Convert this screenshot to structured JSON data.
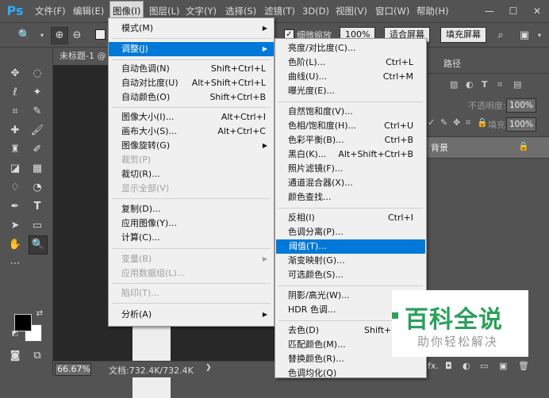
{
  "app": {
    "logo": "Ps"
  },
  "menubar": {
    "items": [
      {
        "label": "文件(F)"
      },
      {
        "label": "编辑(E)"
      },
      {
        "label": "图像(I)"
      },
      {
        "label": "图层(L)"
      },
      {
        "label": "文字(Y)"
      },
      {
        "label": "选择(S)"
      },
      {
        "label": "滤镜(T)"
      },
      {
        "label": "3D(D)"
      },
      {
        "label": "视图(V)"
      },
      {
        "label": "窗口(W)"
      },
      {
        "label": "帮助(H)"
      }
    ],
    "window_buttons": {
      "minimize": "—",
      "maximize": "☐",
      "close": "✕"
    }
  },
  "options_bar": {
    "scrubby_zoom_label": "细微缩放",
    "zoom_100_btn": "100%",
    "fit_screen_btn": "适合屏幕",
    "fill_screen_btn": "填充屏幕"
  },
  "document": {
    "tab_title": "未标题-1 @",
    "zoom_value": "66.67%",
    "doc_info": "文档:732.4K/732.4K"
  },
  "layers_panel": {
    "tab_paths": "路径",
    "opacity_label": "不透明度:",
    "opacity_value": "100%",
    "fill_label": "填充:",
    "fill_value": "100%",
    "layer_name": "背景"
  },
  "image_menu": {
    "items": [
      {
        "label": "模式(M)",
        "shortcut": "",
        "submenu": true,
        "disabled": false,
        "highlighted": false
      },
      {
        "label": "调整(J)",
        "shortcut": "",
        "submenu": true,
        "disabled": false,
        "highlighted": true
      },
      {
        "label": "自动色调(N)",
        "shortcut": "Shift+Ctrl+L",
        "submenu": false,
        "disabled": false,
        "highlighted": false
      },
      {
        "label": "自动对比度(U)",
        "shortcut": "Alt+Shift+Ctrl+L",
        "submenu": false,
        "disabled": false,
        "highlighted": false
      },
      {
        "label": "自动颜色(O)",
        "shortcut": "Shift+Ctrl+B",
        "submenu": false,
        "disabled": false,
        "highlighted": false
      },
      {
        "label": "图像大小(I)...",
        "shortcut": "Alt+Ctrl+I",
        "submenu": false,
        "disabled": false,
        "highlighted": false
      },
      {
        "label": "画布大小(S)...",
        "shortcut": "Alt+Ctrl+C",
        "submenu": false,
        "disabled": false,
        "highlighted": false
      },
      {
        "label": "图像旋转(G)",
        "shortcut": "",
        "submenu": true,
        "disabled": false,
        "highlighted": false
      },
      {
        "label": "裁剪(P)",
        "shortcut": "",
        "submenu": false,
        "disabled": true,
        "highlighted": false
      },
      {
        "label": "裁切(R)...",
        "shortcut": "",
        "submenu": false,
        "disabled": false,
        "highlighted": false
      },
      {
        "label": "显示全部(V)",
        "shortcut": "",
        "submenu": false,
        "disabled": true,
        "highlighted": false
      },
      {
        "label": "复制(D)...",
        "shortcut": "",
        "submenu": false,
        "disabled": false,
        "highlighted": false
      },
      {
        "label": "应用图像(Y)...",
        "shortcut": "",
        "submenu": false,
        "disabled": false,
        "highlighted": false
      },
      {
        "label": "计算(C)...",
        "shortcut": "",
        "submenu": false,
        "disabled": false,
        "highlighted": false
      },
      {
        "label": "变量(B)",
        "shortcut": "",
        "submenu": true,
        "disabled": true,
        "highlighted": false
      },
      {
        "label": "应用数据组(L)...",
        "shortcut": "",
        "submenu": false,
        "disabled": true,
        "highlighted": false
      },
      {
        "label": "陷印(T)...",
        "shortcut": "",
        "submenu": false,
        "disabled": true,
        "highlighted": false
      },
      {
        "label": "分析(A)",
        "shortcut": "",
        "submenu": true,
        "disabled": false,
        "highlighted": false
      }
    ]
  },
  "adjust_menu": {
    "items": [
      {
        "label": "亮度/对比度(C)...",
        "shortcut": "",
        "highlighted": false
      },
      {
        "label": "色阶(L)...",
        "shortcut": "Ctrl+L",
        "highlighted": false
      },
      {
        "label": "曲线(U)...",
        "shortcut": "Ctrl+M",
        "highlighted": false
      },
      {
        "label": "曝光度(E)...",
        "shortcut": "",
        "highlighted": false
      },
      {
        "label": "自然饱和度(V)...",
        "shortcut": "",
        "highlighted": false
      },
      {
        "label": "色相/饱和度(H)...",
        "shortcut": "Ctrl+U",
        "highlighted": false
      },
      {
        "label": "色彩平衡(B)...",
        "shortcut": "Ctrl+B",
        "highlighted": false
      },
      {
        "label": "黑白(K)...",
        "shortcut": "Alt+Shift+Ctrl+B",
        "highlighted": false
      },
      {
        "label": "照片滤镜(F)...",
        "shortcut": "",
        "highlighted": false
      },
      {
        "label": "通道混合器(X)...",
        "shortcut": "",
        "highlighted": false
      },
      {
        "label": "颜色查找...",
        "shortcut": "",
        "highlighted": false
      },
      {
        "label": "反相(I)",
        "shortcut": "Ctrl+I",
        "highlighted": false
      },
      {
        "label": "色调分离(P)...",
        "shortcut": "",
        "highlighted": false
      },
      {
        "label": "阈值(T)...",
        "shortcut": "",
        "highlighted": true
      },
      {
        "label": "渐变映射(G)...",
        "shortcut": "",
        "highlighted": false
      },
      {
        "label": "可选颜色(S)...",
        "shortcut": "",
        "highlighted": false
      },
      {
        "label": "阴影/高光(W)...",
        "shortcut": "",
        "highlighted": false
      },
      {
        "label": "HDR 色调...",
        "shortcut": "",
        "highlighted": false
      },
      {
        "label": "去色(D)",
        "shortcut": "Shift+C",
        "highlighted": false
      },
      {
        "label": "匹配颜色(M)...",
        "shortcut": "",
        "highlighted": false
      },
      {
        "label": "替换颜色(R)...",
        "shortcut": "",
        "highlighted": false
      },
      {
        "label": "色调均化(Q)",
        "shortcut": "",
        "highlighted": false
      }
    ]
  },
  "watermark": {
    "main": "百科全说",
    "sub": "助你轻松解决"
  },
  "colors": {
    "accent": "#0078d7",
    "ps_blue": "#31a8ff",
    "watermark_green": "#2aa05a"
  }
}
